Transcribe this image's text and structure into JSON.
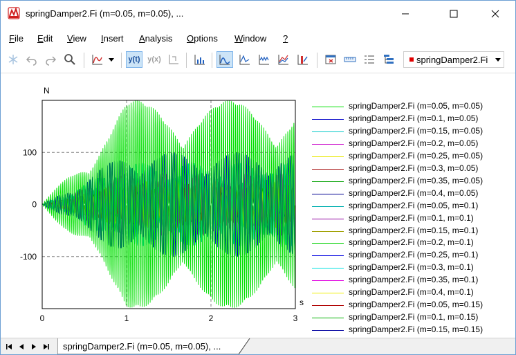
{
  "window": {
    "title": "springDamper2.Fi (m=0.05, m=0.05), ..."
  },
  "menu": {
    "items": [
      "File",
      "Edit",
      "View",
      "Insert",
      "Analysis",
      "Options",
      "Window",
      "?"
    ],
    "underline": [
      "F",
      "E",
      "V",
      "I",
      "A",
      "O",
      "W",
      "?"
    ]
  },
  "toolbar": {
    "y_of_t": "y(t)",
    "y_of_x": "y(x)",
    "selected_signal": "springDamper2.Fi",
    "selected_color": "#e00000"
  },
  "chart_data": {
    "type": "line",
    "xlabel": "s",
    "ylabel": "N",
    "xlim": [
      0,
      3
    ],
    "ylim": [
      -200,
      200
    ],
    "x_ticks": [
      "0",
      "1",
      "2",
      "3"
    ],
    "y_ticks": [
      "100",
      "0",
      "-100"
    ],
    "y_tick_values": [
      100,
      0,
      -100
    ],
    "x_tick_values": [
      0,
      1,
      2,
      3
    ],
    "grid": "dashed-major",
    "legend_position": "right",
    "series": [
      {
        "name": "springDamper2.Fi (m=0.05, m=0.05)",
        "color": "#00e000",
        "amplitude": 200,
        "freq": 42,
        "env_freq": 0.9
      },
      {
        "name": "springDamper2.Fi (m=0.1, m=0.05)",
        "color": "#0000c8",
        "amplitude": 100,
        "freq": 34,
        "env_freq": 1.3
      },
      {
        "name": "springDamper2.Fi (m=0.15, m=0.05)",
        "color": "#00c8c8",
        "amplitude": 80,
        "freq": 29,
        "env_freq": 1.7
      },
      {
        "name": "springDamper2.Fi (m=0.2, m=0.05)",
        "color": "#c800c8",
        "amplitude": 60,
        "freq": 26,
        "env_freq": 2.1
      },
      {
        "name": "springDamper2.Fi (m=0.25, m=0.05)",
        "color": "#e8e800",
        "amplitude": 45,
        "freq": 23,
        "env_freq": 2.5
      },
      {
        "name": "springDamper2.Fi (m=0.3, m=0.05)",
        "color": "#a00000",
        "amplitude": 38,
        "freq": 21,
        "env_freq": 2.8
      },
      {
        "name": "springDamper2.Fi (m=0.35, m=0.05)",
        "color": "#00a000",
        "amplitude": 30,
        "freq": 20,
        "env_freq": 3.1
      },
      {
        "name": "springDamper2.Fi (m=0.4, m=0.05)",
        "color": "#000090",
        "amplitude": 25,
        "freq": 18,
        "env_freq": 3.4
      },
      {
        "name": "springDamper2.Fi (m=0.05, m=0.1)",
        "color": "#00b0b0",
        "amplitude": 60,
        "freq": 30,
        "env_freq": 1.1
      },
      {
        "name": "springDamper2.Fi (m=0.1, m=0.1)",
        "color": "#9000a0",
        "amplitude": 45,
        "freq": 27,
        "env_freq": 1.5
      },
      {
        "name": "springDamper2.Fi (m=0.15, m=0.1)",
        "color": "#a0a000",
        "amplitude": 35,
        "freq": 24,
        "env_freq": 1.9
      },
      {
        "name": "springDamper2.Fi (m=0.2, m=0.1)",
        "color": "#00d000",
        "amplitude": 30,
        "freq": 22,
        "env_freq": 2.3
      },
      {
        "name": "springDamper2.Fi (m=0.25, m=0.1)",
        "color": "#0000e0",
        "amplitude": 25,
        "freq": 20,
        "env_freq": 2.7
      },
      {
        "name": "springDamper2.Fi (m=0.3, m=0.1)",
        "color": "#00e0e0",
        "amplitude": 22,
        "freq": 19,
        "env_freq": 3.0
      },
      {
        "name": "springDamper2.Fi (m=0.35, m=0.1)",
        "color": "#e000e0",
        "amplitude": 20,
        "freq": 18,
        "env_freq": 3.3
      },
      {
        "name": "springDamper2.Fi (m=0.4, m=0.1)",
        "color": "#f0f000",
        "amplitude": 18,
        "freq": 17,
        "env_freq": 3.6
      },
      {
        "name": "springDamper2.Fi (m=0.05, m=0.15)",
        "color": "#b00000",
        "amplitude": 40,
        "freq": 25,
        "env_freq": 1.2
      },
      {
        "name": "springDamper2.Fi (m=0.1, m=0.15)",
        "color": "#00b000",
        "amplitude": 32,
        "freq": 23,
        "env_freq": 1.6
      },
      {
        "name": "springDamper2.Fi (m=0.15, m=0.15)",
        "color": "#0000a0",
        "amplitude": 28,
        "freq": 21,
        "env_freq": 2.0
      }
    ]
  },
  "tabs": {
    "document": "springDamper2.Fi (m=0.05, m=0.05), ..."
  }
}
